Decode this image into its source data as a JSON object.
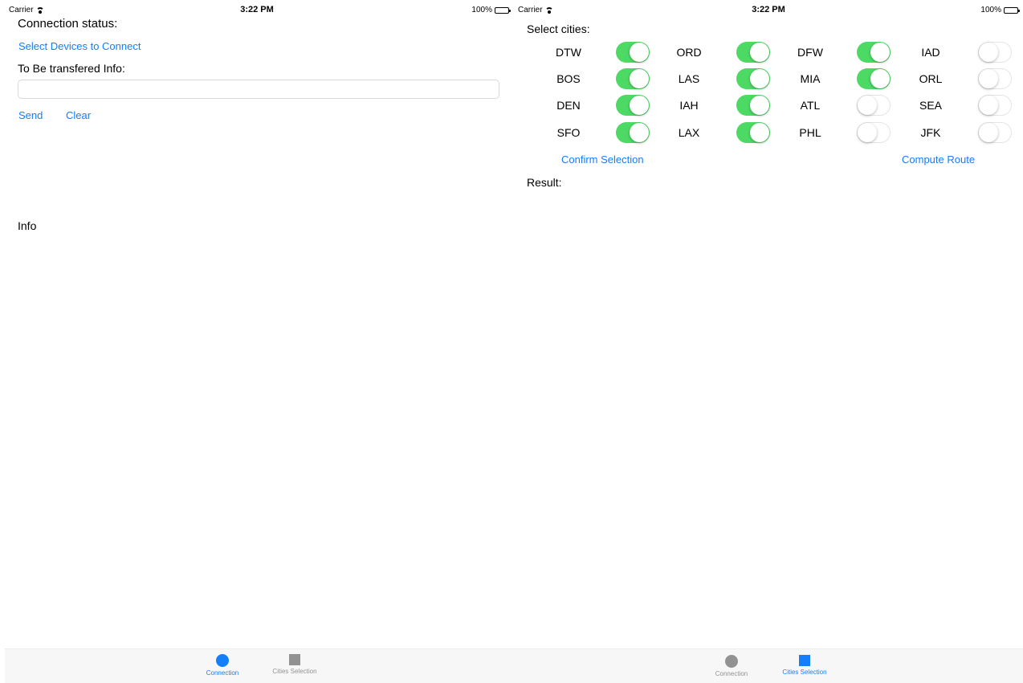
{
  "colors": {
    "accent": "#147efb",
    "toggle_on": "#4cd964",
    "tab_inactive": "#929292"
  },
  "left": {
    "status": {
      "carrier": "Carrier",
      "time": "3:22 PM",
      "battery": "100%"
    },
    "connection_status_label": "Connection status:",
    "select_devices_link": "Select Devices to Connect",
    "to_transfer_label": "To Be transfered Info:",
    "transfer_input": {
      "value": "",
      "placeholder": ""
    },
    "send_button": "Send",
    "clear_button": "Clear",
    "info_label": "Info",
    "tabs": [
      {
        "label": "Connection",
        "icon": "circle-icon",
        "active": true
      },
      {
        "label": "Cities Selection",
        "icon": "square-icon",
        "active": false
      }
    ]
  },
  "right": {
    "status": {
      "carrier": "Carrier",
      "time": "3:22 PM",
      "battery": "100%"
    },
    "select_cities_label": "Select cities:",
    "cities": [
      {
        "code": "DTW",
        "on": true
      },
      {
        "code": "ORD",
        "on": true
      },
      {
        "code": "DFW",
        "on": true
      },
      {
        "code": "IAD",
        "on": false
      },
      {
        "code": "BOS",
        "on": true
      },
      {
        "code": "LAS",
        "on": true
      },
      {
        "code": "MIA",
        "on": true
      },
      {
        "code": "ORL",
        "on": false
      },
      {
        "code": "DEN",
        "on": true
      },
      {
        "code": "IAH",
        "on": true
      },
      {
        "code": "ATL",
        "on": false
      },
      {
        "code": "SEA",
        "on": false
      },
      {
        "code": "SFO",
        "on": true
      },
      {
        "code": "LAX",
        "on": true
      },
      {
        "code": "PHL",
        "on": false
      },
      {
        "code": "JFK",
        "on": false
      }
    ],
    "confirm_button": "Confirm Selection",
    "compute_button": "Compute Route",
    "result_label": "Result:",
    "tabs": [
      {
        "label": "Connection",
        "icon": "circle-icon",
        "active": false
      },
      {
        "label": "Cities Selection",
        "icon": "square-icon",
        "active": true
      }
    ]
  }
}
